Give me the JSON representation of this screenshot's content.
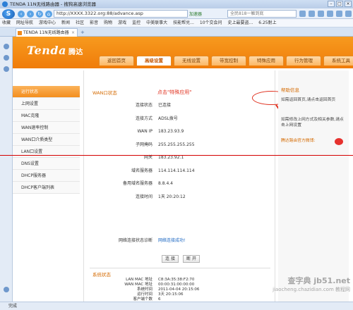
{
  "window": {
    "title": "TENDA 11N无线路由器 - 搜狗高速浏览器"
  },
  "address_bar": {
    "url": "http://XXXX.3322.org:88/advance.asp",
    "accelerator": "加速器",
    "search_placeholder": "全民818一触到底"
  },
  "favorites": [
    "收藏",
    "网址导航",
    "游戏中心",
    "新闻",
    "社区",
    "影音",
    "购物",
    "游戏",
    "监控",
    "中美联事大",
    "技能帮兑...",
    "10个交会问",
    "史上最要盗...",
    "6.25耐上"
  ],
  "tab": {
    "label": "TENDA 11N无线路由器"
  },
  "router": {
    "brand": "Tenda",
    "brand_cn": "腾达",
    "nav": [
      "返回首页",
      "高级设置",
      "无线设置",
      "带宽控制",
      "特殊应用",
      "行为管理",
      "系统工具"
    ],
    "active_nav": 1,
    "menu": [
      "运行状态",
      "上网设置",
      "MAC克隆",
      "WAN速率控制",
      "WAN口介质类型",
      "LAN口设置",
      "DNS设置",
      "DHCP服务器",
      "DHCP客户端列表"
    ],
    "wan_title": "WAN口状态",
    "annotation": "点击\"特殊应用\"",
    "wan_rows": [
      {
        "label": "连接状态",
        "value": "已连接"
      },
      {
        "label": "连接方式",
        "value": "ADSL拨号"
      },
      {
        "label": "WAN IP",
        "value": "183.23.93.9"
      },
      {
        "label": "子网掩码",
        "value": "255.255.255.255"
      },
      {
        "label": "网关",
        "value": "183.23.92.1"
      },
      {
        "label": "域名服务器",
        "value": "114.114.114.114"
      },
      {
        "label": "备用域名服务器",
        "value": "8.8.4.4"
      },
      {
        "label": "连接时间",
        "value": "1天 20:20:12"
      }
    ],
    "diag": {
      "label": "网络连接状态诊断",
      "value": "网络连接成功!"
    },
    "connect_btn": "连 接",
    "disconnect_btn": "断 开",
    "sys_title": "系统状态",
    "sys_rows": [
      {
        "label": "LAN MAC 地址",
        "value": "C8:3A:35:38:F2:70"
      },
      {
        "label": "WAN MAC 地址",
        "value": "00:00:31:00:00:00"
      },
      {
        "label": "系统时间",
        "value": "2011-04-04 20:15:06"
      },
      {
        "label": "运行时间",
        "value": "3天 20:15:06"
      },
      {
        "label": "客户端个数",
        "value": "6"
      }
    ],
    "help": {
      "title": "帮助信息",
      "p1": "如需返回首页,请点击返回首页",
      "p2": "如需修改上网方式及相关参数,请点击上网设置",
      "weibo": "腾达路由官方微博:"
    }
  },
  "status_bar": {
    "text": "完成"
  },
  "watermark": {
    "main": "查字典 jb51.net",
    "sub": "jiaocheng.chazidian.com 教程网"
  }
}
